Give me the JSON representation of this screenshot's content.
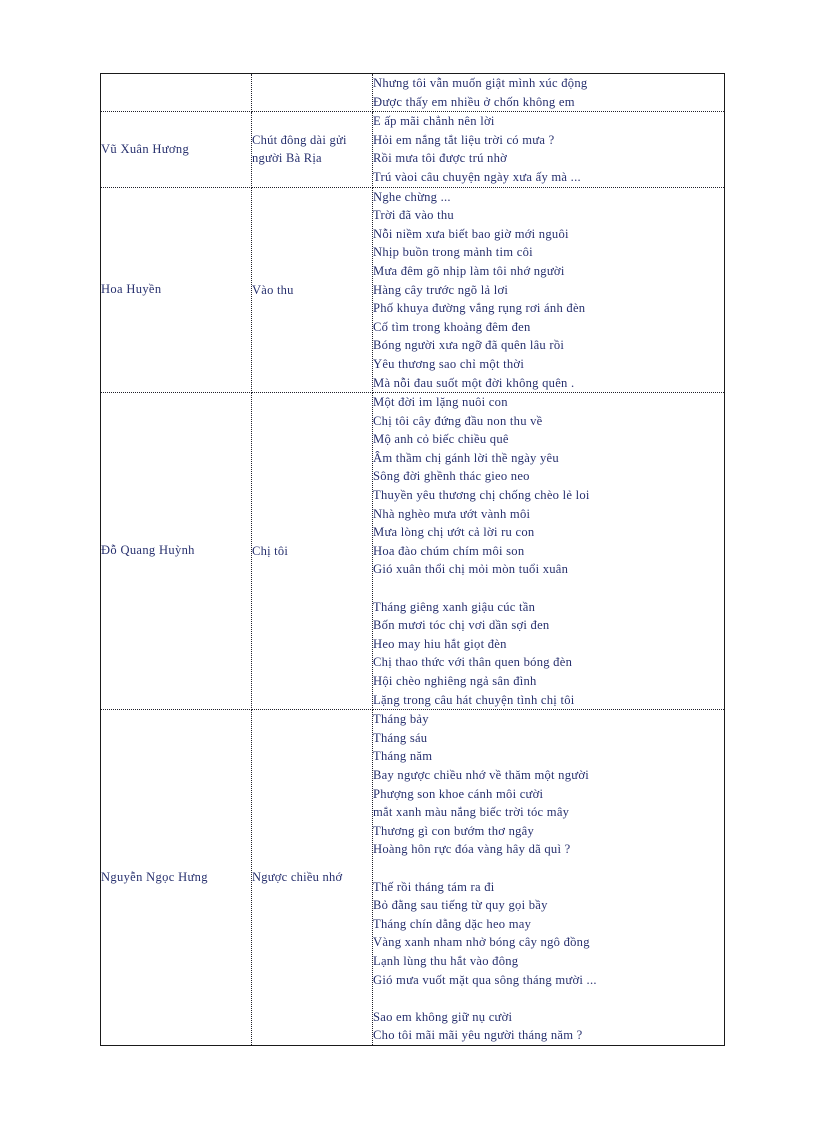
{
  "document": {
    "type": "poem-anthology-table",
    "text_color": "#27306e",
    "background_color": "#ffffff",
    "columns": [
      "author",
      "title",
      "poem_text"
    ]
  },
  "table": {
    "rows": [
      {
        "author": "",
        "title": "",
        "stanzas": [
          [
            "Nhưng tôi vẫn muốn giật mình xúc động",
            "Được thấy em nhiều ở chốn không em"
          ]
        ]
      },
      {
        "author": "Vũ Xuân Hương",
        "title": "Chút đông dài gửi người Bà Rịa",
        "stanzas": [
          [
            "E ấp mãi chẳnh nên lời",
            "Hỏi em nắng tắt liệu trời có mưa ?",
            "Rồi mưa tôi được trú nhờ",
            "Trú vàoi câu chuyện ngày xưa ấy mà ..."
          ]
        ]
      },
      {
        "author": "Hoa Huyền",
        "title": "Vào thu",
        "stanzas": [
          [
            "Nghe chừng ...",
            "Trời đã vào thu",
            "Nỗi niềm xưa biết bao giờ mới nguôi",
            "Nhịp buồn trong mảnh tim côi",
            "Mưa đêm gõ nhịp làm tôi nhớ người",
            "Hàng cây trước ngõ lả lơi",
            "Phố khuya đường vắng rụng rơi ánh đèn",
            "Cố tìm trong khoảng đêm đen",
            "Bóng người xưa ngỡ đã quên lâu rồi",
            "Yêu thương sao chỉ một thời",
            "Mà nỗi đau suốt một đời không quên ."
          ]
        ]
      },
      {
        "author": "Đỗ Quang Huỳnh",
        "title": "Chị tôi",
        "stanzas": [
          [
            "Một đời im lặng nuôi con",
            "Chị tôi cây đứng đầu non thu về",
            "Mộ anh cỏ biếc chiều quê",
            "Âm thầm chị gánh lời thề ngày yêu",
            "Sông đời ghềnh thác gieo neo",
            "Thuyền yêu thương chị chống chèo lẻ loi",
            "Nhà nghèo mưa ướt vành môi",
            "Mưa lòng chị ướt cả lời ru con",
            "Hoa đào chúm chím môi son",
            "Gió xuân thổi chị mỏi mòn tuổi xuân"
          ],
          [
            "Tháng giêng xanh giậu cúc tần",
            "Bốn mươi tóc chị vơi dần sợi đen",
            "Heo may hiu hắt giọt đèn",
            "Chị thao thức với thân quen bóng đèn",
            "Hội chèo nghiêng ngả sân đình",
            "Lặng trong câu hát chuyện tình chị tôi"
          ]
        ]
      },
      {
        "author": "Nguyễn Ngọc Hưng",
        "title": "Ngược chiều nhớ",
        "stanzas": [
          [
            "Tháng bảy",
            "Tháng sáu",
            "Tháng năm",
            "Bay ngược chiều nhớ về thăm một người",
            "Phượng son khoe cánh môi cười",
            "mắt xanh màu nắng biếc trời tóc mây",
            "Thương gì con bướm thơ ngây",
            "Hoàng hôn rực đóa vàng hây dã quì ?"
          ],
          [
            "Thế rồi tháng tám ra đi",
            "Bỏ đằng sau tiếng từ quy gọi bầy",
            "Tháng chín dằng dặc heo may",
            "Vàng xanh nham nhở bóng cây ngô đồng",
            "Lạnh lùng thu hắt vào đông",
            "Gió mưa vuốt mặt qua sông tháng mười ..."
          ],
          [
            "Sao em không giữ nụ cười",
            "Cho tôi mãi mãi yêu người tháng năm ?"
          ]
        ]
      }
    ]
  }
}
